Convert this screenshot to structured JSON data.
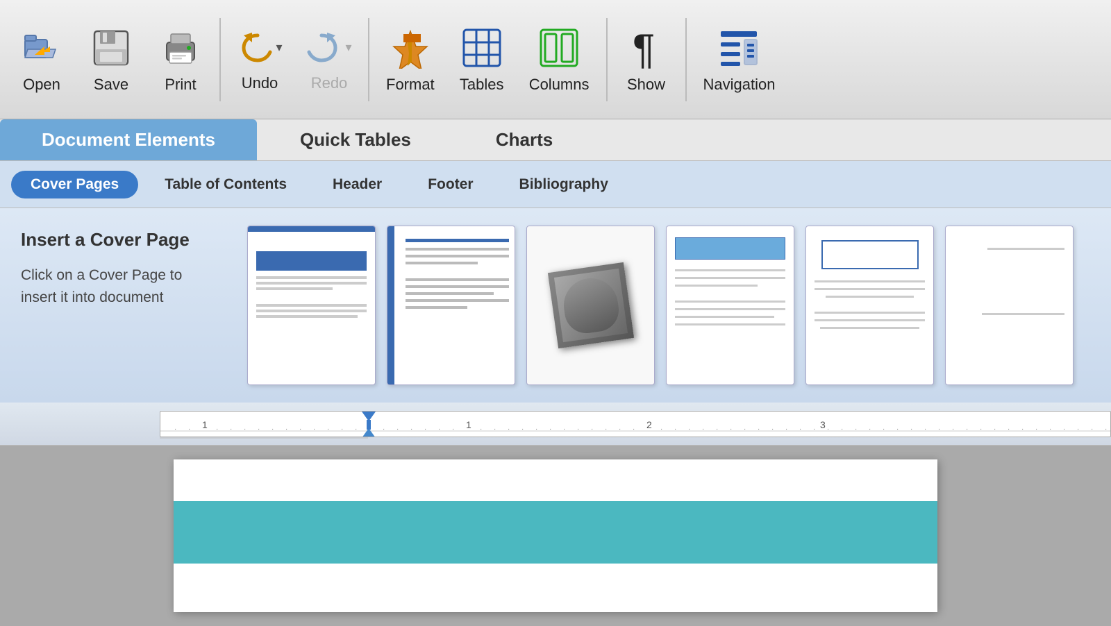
{
  "toolbar": {
    "items": [
      {
        "id": "open",
        "label": "Open",
        "icon": "open-icon"
      },
      {
        "id": "save",
        "label": "Save",
        "icon": "save-icon"
      },
      {
        "id": "print",
        "label": "Print",
        "icon": "print-icon"
      },
      {
        "id": "undo",
        "label": "Undo",
        "icon": "undo-icon",
        "has_arrow": true
      },
      {
        "id": "redo",
        "label": "Redo",
        "icon": "redo-icon",
        "has_arrow": true,
        "disabled": true
      },
      {
        "id": "format",
        "label": "Format",
        "icon": "format-icon"
      },
      {
        "id": "tables",
        "label": "Tables",
        "icon": "tables-icon"
      },
      {
        "id": "columns",
        "label": "Columns",
        "icon": "columns-icon"
      },
      {
        "id": "show",
        "label": "Show",
        "icon": "show-icon"
      },
      {
        "id": "navigation",
        "label": "Navigation",
        "icon": "navigation-icon"
      }
    ]
  },
  "ribbon": {
    "tabs": [
      {
        "id": "document-elements",
        "label": "Document Elements",
        "active": true
      },
      {
        "id": "quick-tables",
        "label": "Quick Tables",
        "active": false
      },
      {
        "id": "charts",
        "label": "Charts",
        "active": false
      }
    ]
  },
  "sub_tabs": [
    {
      "id": "cover-pages",
      "label": "Cover Pages",
      "active": true
    },
    {
      "id": "toc",
      "label": "Table of Contents",
      "active": false
    },
    {
      "id": "header",
      "label": "Header",
      "active": false
    },
    {
      "id": "footer",
      "label": "Footer",
      "active": false
    },
    {
      "id": "bibliography",
      "label": "Bibliography",
      "active": false
    }
  ],
  "cover_page": {
    "title": "Insert a Cover Page",
    "description": "Click on a Cover Page to insert it into document",
    "thumbnails": [
      {
        "id": "thumb1",
        "style": "dark-bar"
      },
      {
        "id": "thumb2",
        "style": "sidebar"
      },
      {
        "id": "thumb3",
        "style": "photo"
      },
      {
        "id": "thumb4",
        "style": "box-top"
      },
      {
        "id": "thumb5",
        "style": "box-center"
      },
      {
        "id": "thumb6",
        "style": "box-right"
      }
    ]
  },
  "ruler": {
    "numbers": [
      "1",
      "1",
      "2",
      "3"
    ],
    "marker_position": "33%"
  }
}
